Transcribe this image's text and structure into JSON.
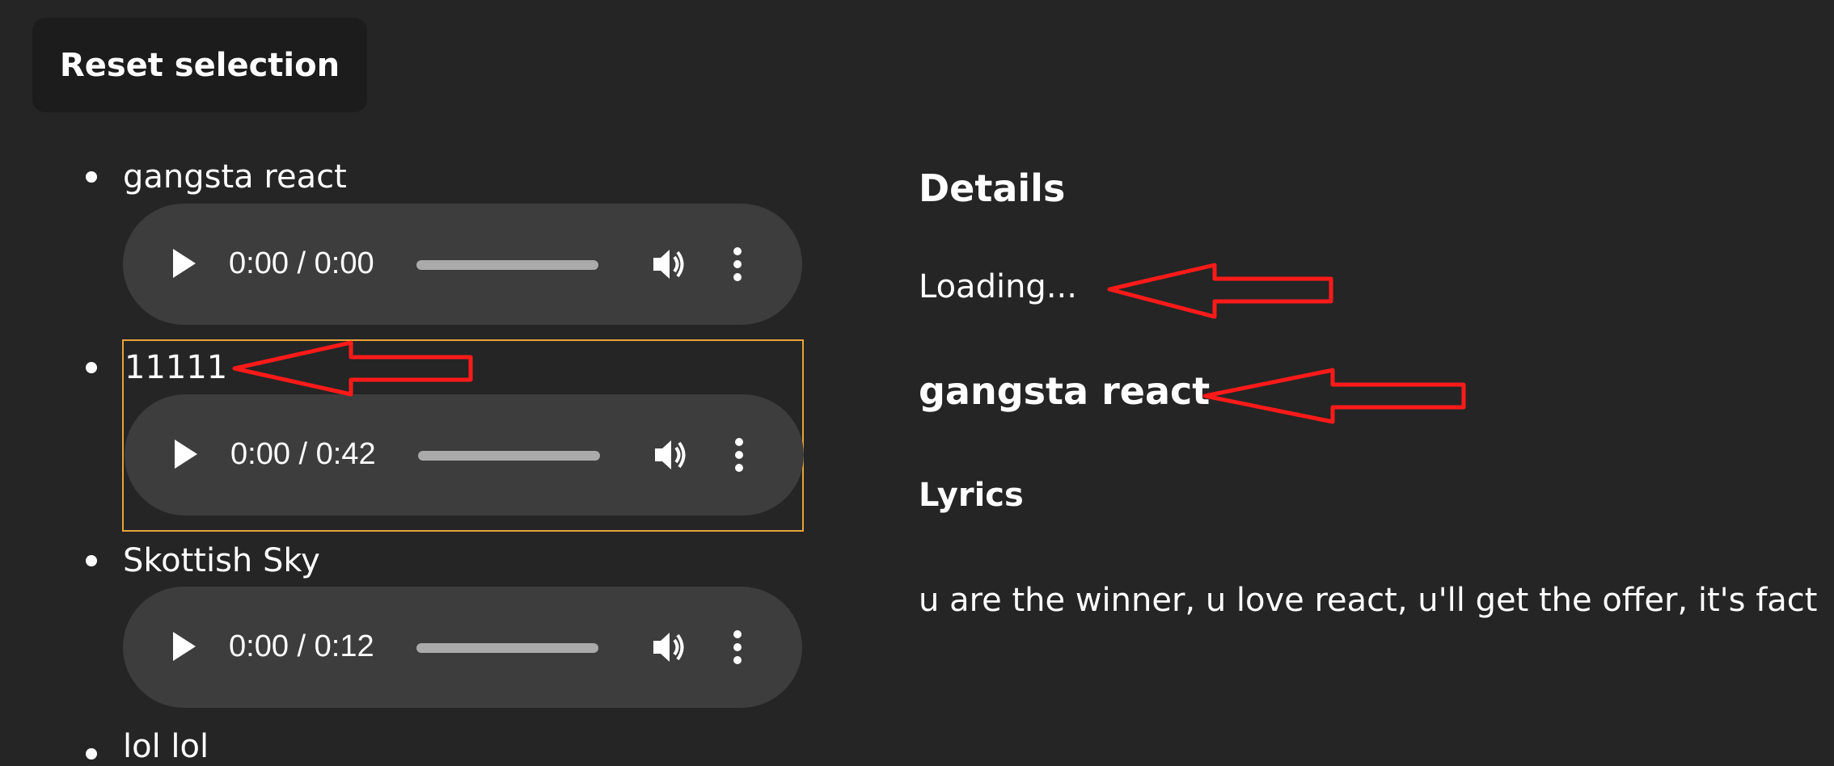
{
  "toolbar": {
    "reset_label": "Reset selection"
  },
  "tracks": [
    {
      "name": "gangsta react",
      "time": "0:00 / 0:00",
      "progress": 0
    },
    {
      "name": "11111",
      "time": "0:00 / 0:42",
      "progress": 0
    },
    {
      "name": "Skottish Sky",
      "time": "0:00 / 0:12",
      "progress": 0
    },
    {
      "name": "lol lol"
    }
  ],
  "details": {
    "heading": "Details",
    "status": "Loading...",
    "song_title": "gangsta react",
    "lyrics_heading": "Lyrics",
    "lyrics": "u are the winner, u love react, u'll get the offer, it's fact"
  },
  "icons": {
    "play": "play-icon",
    "volume": "volume-icon",
    "more": "more-vertical-icon",
    "annotation": "red-arrow-annotation"
  },
  "colors": {
    "background": "#252525",
    "player": "#3d3d3d",
    "button": "#1c1c1c",
    "focus": "#e8a33a",
    "annotation": "#ff1a1a"
  }
}
